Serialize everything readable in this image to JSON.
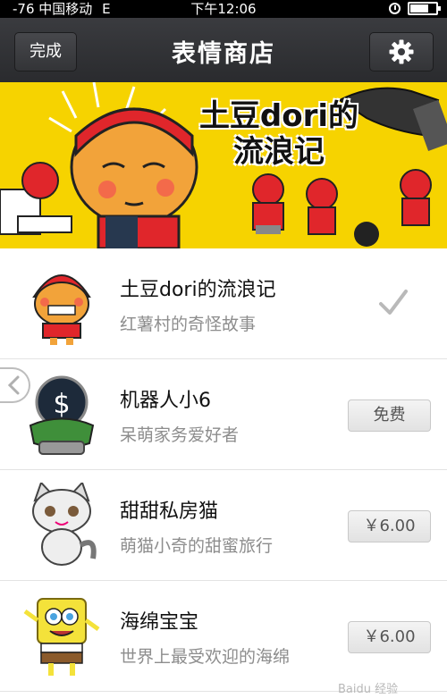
{
  "status_bar": {
    "signal": "-76",
    "carrier": "中国移动",
    "network": "E",
    "time": "下午12:06"
  },
  "nav": {
    "title": "表情商店",
    "done_label": "完成"
  },
  "banner": {
    "title_line1": "土豆dori的",
    "title_line2": "流浪记"
  },
  "stickers": [
    {
      "name": "土豆dori的流浪记",
      "desc": "红薯村的奇怪故事",
      "status": "owned"
    },
    {
      "name": "机器人小6",
      "desc": "呆萌家务爱好者",
      "price": "免费"
    },
    {
      "name": "甜甜私房猫",
      "desc": "萌猫小奇的甜蜜旅行",
      "price": "￥6.00"
    },
    {
      "name": "海绵宝宝",
      "desc": "世界上最受欢迎的海绵",
      "price": "￥6.00"
    }
  ],
  "watermark": "Baidu 经验",
  "colors": {
    "nav_bg": "#2e2f32",
    "banner_bg": "#f6d300",
    "desc_text": "#8d8d8d"
  }
}
